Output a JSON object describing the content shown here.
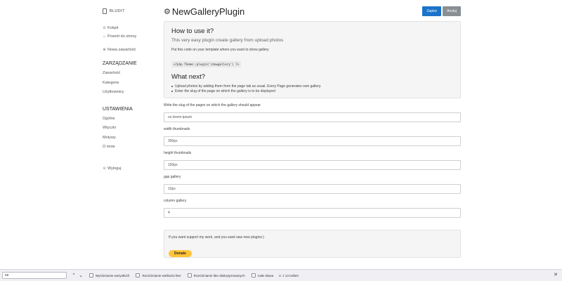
{
  "sidebar": {
    "brand": "BLUDIT",
    "links": [
      {
        "icon": "dashboard-icon",
        "glyph": "⊙",
        "label": "Kokpit"
      },
      {
        "icon": "home-icon",
        "glyph": "⌂",
        "label": "Powrót do strony"
      }
    ],
    "new_content": {
      "icon": "plus-circle-icon",
      "glyph": "⊕",
      "label": "Nowa zawartość"
    },
    "manage_heading": "ZARZĄDZANIE",
    "manage_items": [
      "Zawartość",
      "Kategorie",
      "Użytkownicy"
    ],
    "settings_heading": "USTAWIENIA",
    "settings_items": [
      "Ogólne",
      "Wtyczki",
      "Motywy",
      "O mnie"
    ],
    "logout": {
      "icon": "logout-icon",
      "glyph": "⊙",
      "label": "Wyloguj"
    }
  },
  "header": {
    "title": "NewGalleryPlugin",
    "save_label": "Zapisz",
    "cancel_label": "Anuluj"
  },
  "info": {
    "heading": "How to use it?",
    "lead": "This very easy plugin create gallery from upload photos",
    "instruction": "Put this code on your template where you want to show gallery",
    "code": "<?php Theme::plugin('showgallery') ?>",
    "next_heading": "What next?",
    "bullets": [
      "Upload photos by adding them from the page tab as usual. Every Page generates own gallery.",
      "Enter the slug of the page on which the gallery is to be displayed"
    ]
  },
  "fields": [
    {
      "label": "Write the slug of the pages on which the gallery should appear",
      "value": "ce,lorem-ipsum"
    },
    {
      "label": "width thumbnails",
      "value": "350px"
    },
    {
      "label": "height thumbnails",
      "value": "150px"
    },
    {
      "label": "gap gallery",
      "value": "10px"
    },
    {
      "label": "column gallery",
      "value": "4"
    }
  ],
  "support": {
    "text": "If you want support my work, and you want saw new plugins:)",
    "donate_label": "Donate"
  },
  "findbar": {
    "value": "ce",
    "options": [
      "Wyróżnianie wszystkich",
      "Rozróżnianie wielkości liter",
      "Rozróżnianie liter diakrytyzowanych",
      "Całe słowa"
    ],
    "count": "2. z 13 trafień"
  },
  "colors": {
    "primary": "#1a73c9",
    "secondary": "#8a8f94",
    "donate": "#ffc439"
  }
}
